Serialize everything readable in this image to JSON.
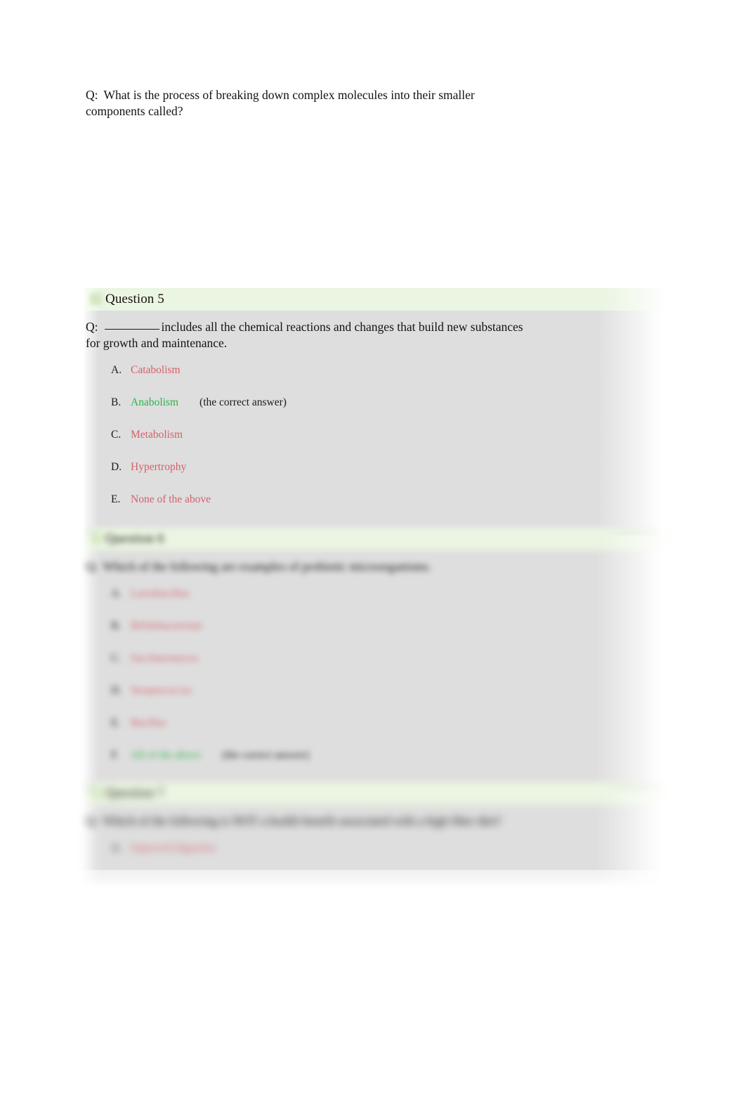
{
  "intro_question": {
    "label": "Q:",
    "text": "What is the process of breaking down complex molecules into their smaller components called?"
  },
  "colors": {
    "wrong_answer": "#d4606a",
    "correct_answer": "#2db34a",
    "header_band": "#eaf5e2",
    "body_panel": "#dedede",
    "bullet": "#cfe3b8"
  },
  "questions": [
    {
      "title": "Question 5",
      "label": "Q:",
      "text_before_blank": "",
      "text_after_blank": "includes all the chemical reactions and changes that build new substances for growth and maintenance.",
      "has_blank": true,
      "blur": "none",
      "options": [
        {
          "letter": "A.",
          "text": "Catabolism",
          "state": "wrong",
          "note": ""
        },
        {
          "letter": "B.",
          "text": "Anabolism",
          "state": "correct",
          "note": "(the correct answer)"
        },
        {
          "letter": "C.",
          "text": "Metabolism",
          "state": "wrong",
          "note": ""
        },
        {
          "letter": "D.",
          "text": "Hypertrophy",
          "state": "wrong",
          "note": ""
        },
        {
          "letter": "E.",
          "text": "None of the above",
          "state": "wrong",
          "note": ""
        }
      ]
    },
    {
      "title": "Question 6",
      "label": "Q:",
      "text_before_blank": "Which of the following are examples of probiotic microorganisms.",
      "text_after_blank": "",
      "has_blank": false,
      "blur": "blur-2",
      "options": [
        {
          "letter": "A.",
          "text": "Lactobacillus",
          "state": "wrong",
          "note": ""
        },
        {
          "letter": "B.",
          "text": "Bifidobacterium",
          "state": "wrong",
          "note": ""
        },
        {
          "letter": "C.",
          "text": "Saccharomyces",
          "state": "wrong",
          "note": ""
        },
        {
          "letter": "D.",
          "text": "Streptococcus",
          "state": "wrong",
          "note": ""
        },
        {
          "letter": "E.",
          "text": "Bacillus",
          "state": "wrong",
          "note": ""
        },
        {
          "letter": "F.",
          "text": "All of the above",
          "state": "correct",
          "note": "(the correct answer)"
        }
      ]
    },
    {
      "title": "Question 7",
      "label": "Q:",
      "text_before_blank": "Which of the following is NOT a health benefit associated with a high fiber diet?",
      "text_after_blank": "",
      "has_blank": false,
      "blur": "blur-3",
      "options": [
        {
          "letter": "A.",
          "text": "Improved digestion",
          "state": "wrong",
          "note": ""
        }
      ]
    }
  ]
}
